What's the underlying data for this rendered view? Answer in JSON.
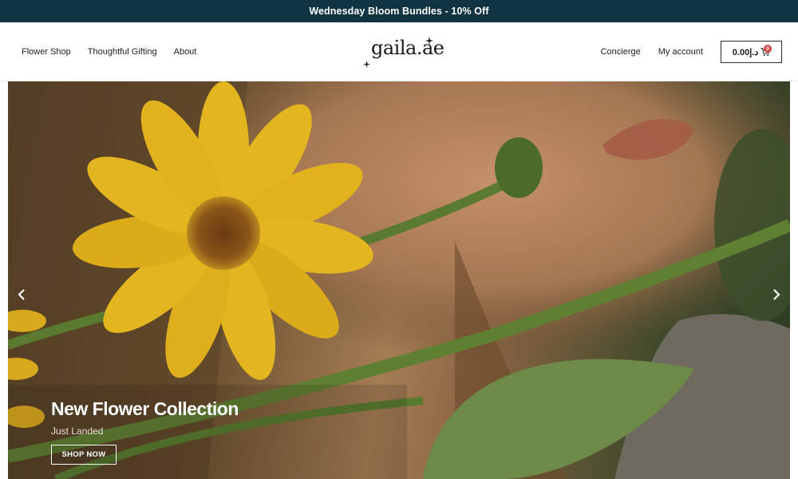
{
  "announcement": {
    "text": "Wednesday Bloom Bundles - 10% Off"
  },
  "header": {
    "nav_left": [
      {
        "label": "Flower Shop"
      },
      {
        "label": "Thoughtful Gifting"
      },
      {
        "label": "About"
      }
    ],
    "logo": {
      "text": "gaila.ae"
    },
    "nav_right": [
      {
        "label": "Concierge"
      },
      {
        "label": "My account"
      }
    ],
    "cart": {
      "amount": "0.00د.إ",
      "count": "0",
      "icon": "cart-icon"
    }
  },
  "hero": {
    "title": "New Flower Collection",
    "subtitle": "Just Landed",
    "button_label": "SHOP NOW",
    "prev_icon": "chevron-left-icon",
    "next_icon": "chevron-right-icon"
  },
  "colors": {
    "announcement_bg": "#0f3340",
    "badge": "#d6453d",
    "flower_yellow": "#e3b51f"
  }
}
